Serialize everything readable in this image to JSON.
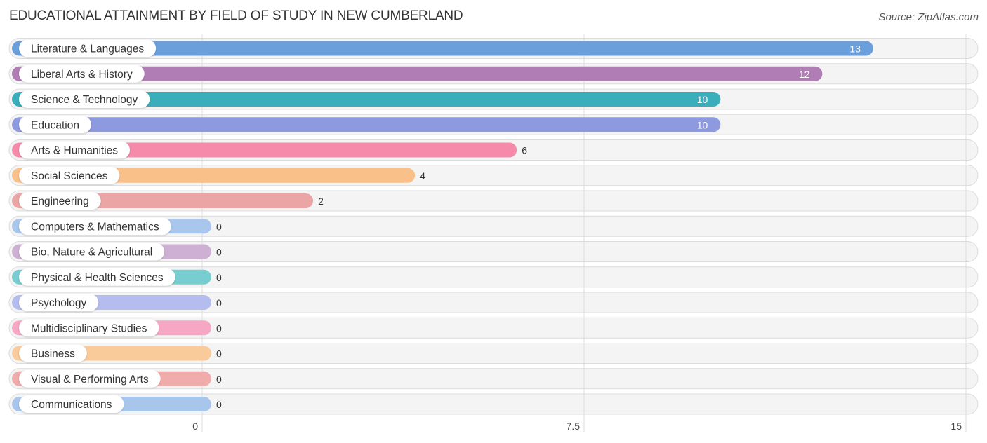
{
  "header": {
    "title": "EDUCATIONAL ATTAINMENT BY FIELD OF STUDY IN NEW CUMBERLAND",
    "source": "Source: ZipAtlas.com"
  },
  "chart_data": {
    "type": "bar",
    "orientation": "horizontal",
    "title": "EDUCATIONAL ATTAINMENT BY FIELD OF STUDY IN NEW CUMBERLAND",
    "xlabel": "",
    "ylabel": "",
    "xlim": [
      0,
      15
    ],
    "xticks": [
      0,
      7.5,
      15
    ],
    "xtick_labels": [
      "0",
      "7.5",
      "15"
    ],
    "grid": true,
    "legend": "none",
    "categories": [
      "Literature & Languages",
      "Liberal Arts & History",
      "Science & Technology",
      "Education",
      "Arts & Humanities",
      "Social Sciences",
      "Engineering",
      "Computers & Mathematics",
      "Bio, Nature & Agricultural",
      "Physical & Health Sciences",
      "Psychology",
      "Multidisciplinary Studies",
      "Business",
      "Visual & Performing Arts",
      "Communications"
    ],
    "values": [
      13,
      12,
      10,
      10,
      6,
      4,
      2,
      0,
      0,
      0,
      0,
      0,
      0,
      0,
      0
    ],
    "colors": [
      "#6a9fdc",
      "#b07db5",
      "#3aaebb",
      "#8e9ae0",
      "#f68aab",
      "#f9c08a",
      "#eca5a5",
      "#a9c7ec",
      "#cdb0d3",
      "#78cdd0",
      "#b5bdef",
      "#f6a7c3",
      "#f9ca9a",
      "#f0abab",
      "#a8c6ec"
    ]
  }
}
